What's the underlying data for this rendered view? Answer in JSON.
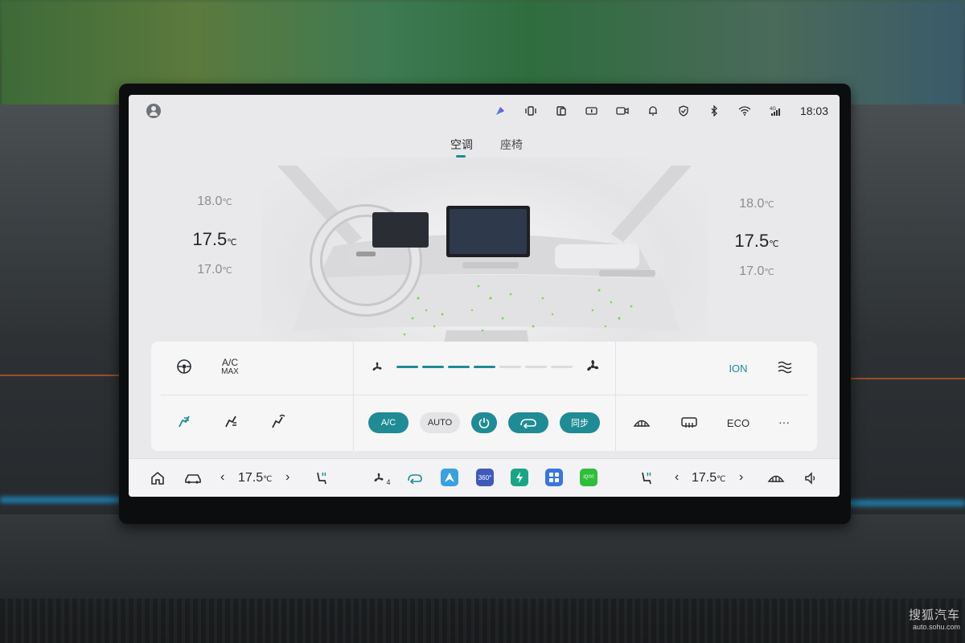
{
  "status_bar": {
    "time": "18:03",
    "network": "4G",
    "icons": [
      "avatar-icon",
      "app-indicator-icon",
      "vibration-icon",
      "cast-icon",
      "battery-icon",
      "dashcam-icon",
      "bell-icon",
      "shield-icon",
      "bluetooth-icon",
      "wifi-icon",
      "signal-icon"
    ]
  },
  "tabs": [
    {
      "label": "空调",
      "active": true
    },
    {
      "label": "座椅",
      "active": false
    }
  ],
  "accent_color": "#1f8b95",
  "left_zone": {
    "temp_above": "18.0",
    "temp_current": "17.5",
    "temp_below": "17.0"
  },
  "right_zone": {
    "temp_above": "18.0",
    "temp_current": "17.5",
    "temp_below": "17.0"
  },
  "unit": "℃",
  "controls": {
    "row1_left": {
      "steering_heat_icon": "steering-wheel-heat-icon",
      "ac_max_line1": "A/C",
      "ac_max_line2": "MAX"
    },
    "fan": {
      "level": 4,
      "max": 7,
      "low_icon": "fan-small-icon",
      "high_icon": "fan-large-icon"
    },
    "row1_right": {
      "ion_label": "ION",
      "airflow_icon": "airflow-icon"
    },
    "row2_left": {
      "icons": [
        "airflow-face-icon",
        "airflow-feet-icon",
        "airflow-defrost-icon"
      ]
    },
    "row2_center": {
      "ac_label": "A/C",
      "auto_label": "AUTO",
      "power_icon": "power-icon",
      "recirc_icon": "recirculation-icon",
      "sync_label": "同步"
    },
    "row2_right": {
      "front_defrost_icon": "front-defrost-icon",
      "rear_defrost_icon": "rear-defrost-icon",
      "eco_label": "ECO",
      "more_label": "···"
    }
  },
  "dock": {
    "left_temp": "17.5",
    "right_temp": "17.5",
    "unit": "℃",
    "left_chev": "‹",
    "right_chev": "›",
    "fan_level": "4",
    "apps": [
      {
        "name": "navigation-app-icon",
        "color": "#3aa1e0"
      },
      {
        "name": "360-camera-app-icon",
        "label": "360°",
        "color": "#3e5ab8"
      },
      {
        "name": "charging-app-icon",
        "color": "#18a685"
      },
      {
        "name": "apps-grid-icon",
        "color": "#3a74e0"
      },
      {
        "name": "iqiyi-app-icon",
        "label": "iQIYI",
        "color": "#2fbe3a"
      }
    ]
  },
  "watermark": {
    "line1": "搜狐汽车",
    "line2": "auto.sohu.com"
  }
}
